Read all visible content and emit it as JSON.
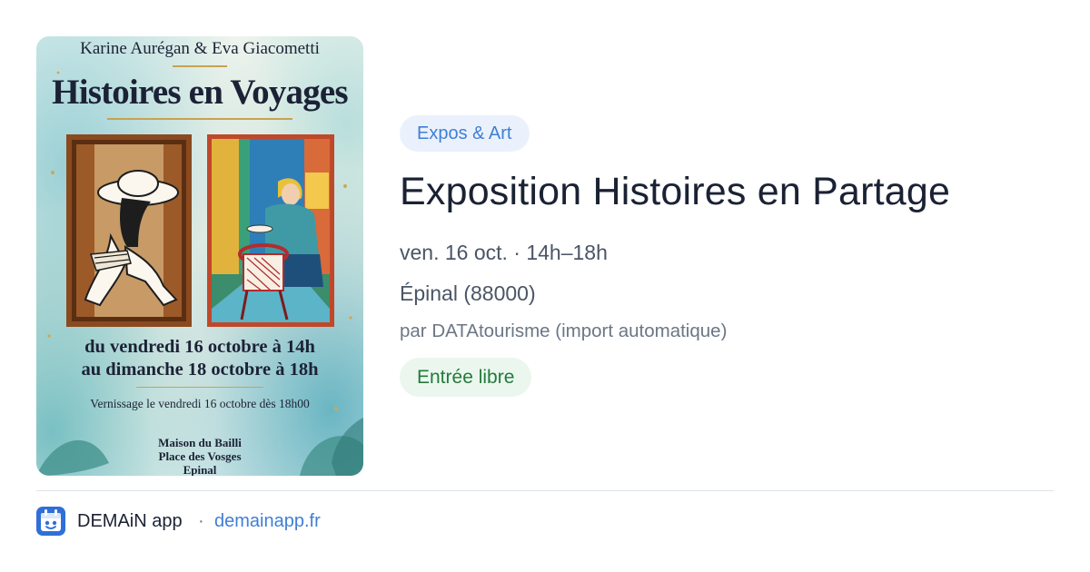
{
  "poster": {
    "authors": "Karine Aurégan & Eva Giacometti",
    "title": "Histoires en Voyages",
    "dates_line1": "du vendredi 16 octobre à 14h",
    "dates_line2": "au dimanche 18 octobre à 18h",
    "vernissage": "Vernissage le vendredi 16 octobre dès 18h00",
    "place_line1": "Maison du Bailli",
    "place_line2": "Place des Vosges",
    "place_line3": "Epinal"
  },
  "event": {
    "category": "Expos & Art",
    "title": "Exposition Histoires en Partage",
    "when": "ven. 16 oct. · 14h–18h",
    "where": "Épinal (88000)",
    "source": "par DATAtourisme (import automatique)",
    "price": "Entrée libre"
  },
  "footer": {
    "app_name": "DEMAiN app",
    "separator": "·",
    "link": "demainapp.fr",
    "icon": "demain-app-icon"
  },
  "colors": {
    "tag_bg": "#eaf1fc",
    "tag_text": "#3f7fd6",
    "free_bg": "#ebf7ee",
    "free_text": "#237a3c",
    "title_text": "#1a2233",
    "meta_text": "#4a5566",
    "link": "#3f7fd6"
  }
}
